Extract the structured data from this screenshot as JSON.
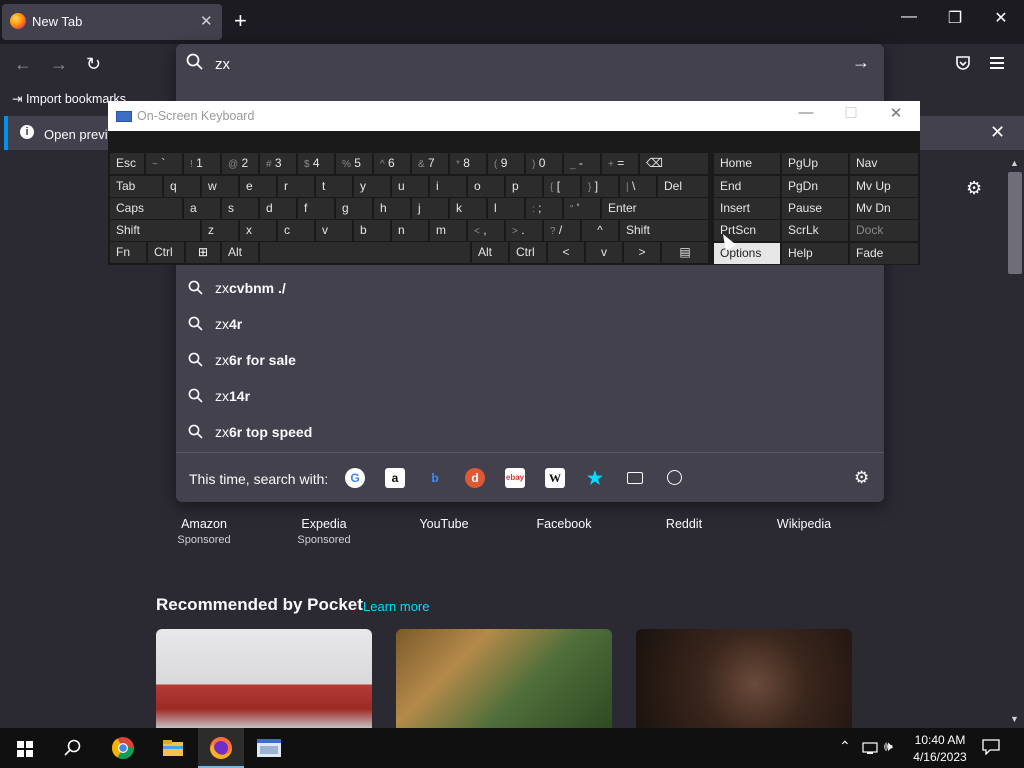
{
  "browser": {
    "tab_title": "New Tab",
    "url_text": "zx",
    "bookmarks": [
      "Import bookmarks"
    ],
    "notification_text": "Open previo"
  },
  "suggestions": [
    {
      "typed": "zx",
      "completion": "cvbnm ./"
    },
    {
      "typed": "zx",
      "completion": "4r"
    },
    {
      "typed": "zx",
      "completion": "6r for sale"
    },
    {
      "typed": "zx",
      "completion": "14r"
    },
    {
      "typed": "zx",
      "completion": "6r top speed"
    }
  ],
  "search_with": {
    "label": "This time, search with:",
    "engines": [
      "google-icon",
      "amazon-icon",
      "bing-icon",
      "duckduckgo-icon",
      "ebay-icon",
      "wikipedia-icon",
      "bookmarks-icon",
      "tabs-icon",
      "history-icon"
    ]
  },
  "top_sites": [
    {
      "name": "Amazon",
      "sponsored": "Sponsored"
    },
    {
      "name": "Expedia",
      "sponsored": "Sponsored"
    },
    {
      "name": "YouTube",
      "sponsored": ""
    },
    {
      "name": "Facebook",
      "sponsored": ""
    },
    {
      "name": "Reddit",
      "sponsored": ""
    },
    {
      "name": "Wikipedia",
      "sponsored": ""
    }
  ],
  "pocket": {
    "title": "Recommended by Pocket",
    "learn_more": "Learn more"
  },
  "osk": {
    "title": "On-Screen Keyboard",
    "rows": [
      [
        [
          "Esc",
          ""
        ],
        [
          "`",
          "~"
        ],
        [
          "1",
          "!"
        ],
        [
          "2",
          "@"
        ],
        [
          "3",
          "#"
        ],
        [
          "4",
          "$"
        ],
        [
          "5",
          "%"
        ],
        [
          "6",
          "^"
        ],
        [
          "7",
          "&"
        ],
        [
          "8",
          "*"
        ],
        [
          "9",
          "("
        ],
        [
          "0",
          ")"
        ],
        [
          "-",
          "_"
        ],
        [
          "=",
          "+"
        ],
        [
          "⌫",
          ""
        ]
      ],
      [
        [
          "Tab",
          ""
        ],
        [
          "q",
          ""
        ],
        [
          "w",
          ""
        ],
        [
          "e",
          ""
        ],
        [
          "r",
          ""
        ],
        [
          "t",
          ""
        ],
        [
          "y",
          ""
        ],
        [
          "u",
          ""
        ],
        [
          "i",
          ""
        ],
        [
          "o",
          ""
        ],
        [
          "p",
          ""
        ],
        [
          "[",
          "{"
        ],
        [
          "]",
          "}"
        ],
        [
          "\\",
          "|"
        ],
        [
          "Del",
          ""
        ]
      ],
      [
        [
          "Caps",
          ""
        ],
        [
          "a",
          ""
        ],
        [
          "s",
          ""
        ],
        [
          "d",
          ""
        ],
        [
          "f",
          ""
        ],
        [
          "g",
          ""
        ],
        [
          "h",
          ""
        ],
        [
          "j",
          ""
        ],
        [
          "k",
          ""
        ],
        [
          "l",
          ""
        ],
        [
          ";",
          ":"
        ],
        [
          "'",
          "\""
        ],
        [
          "Enter",
          ""
        ]
      ],
      [
        [
          "Shift",
          ""
        ],
        [
          "z",
          ""
        ],
        [
          "x",
          ""
        ],
        [
          "c",
          ""
        ],
        [
          "v",
          ""
        ],
        [
          "b",
          ""
        ],
        [
          "n",
          ""
        ],
        [
          "m",
          ""
        ],
        [
          ",",
          "<"
        ],
        [
          ".",
          ">"
        ],
        [
          "/",
          "?"
        ],
        [
          "^",
          ""
        ],
        [
          "Shift",
          ""
        ]
      ],
      [
        [
          "Fn",
          ""
        ],
        [
          "Ctrl",
          ""
        ],
        [
          "⊞",
          ""
        ],
        [
          "Alt",
          ""
        ],
        [
          "",
          ""
        ],
        [
          "Alt",
          ""
        ],
        [
          "Ctrl",
          ""
        ],
        [
          "<",
          ""
        ],
        [
          "v",
          ""
        ],
        [
          ">",
          ""
        ],
        [
          "▤",
          ""
        ]
      ]
    ],
    "side": [
      [
        "Home",
        "PgUp",
        "Nav"
      ],
      [
        "End",
        "PgDn",
        "Mv Up"
      ],
      [
        "Insert",
        "Pause",
        "Mv Dn"
      ],
      [
        "PrtScn",
        "ScrLk",
        "Dock"
      ],
      [
        "Options",
        "Help",
        "Fade"
      ]
    ]
  },
  "taskbar": {
    "time": "10:40 AM",
    "date": "4/16/2023"
  }
}
